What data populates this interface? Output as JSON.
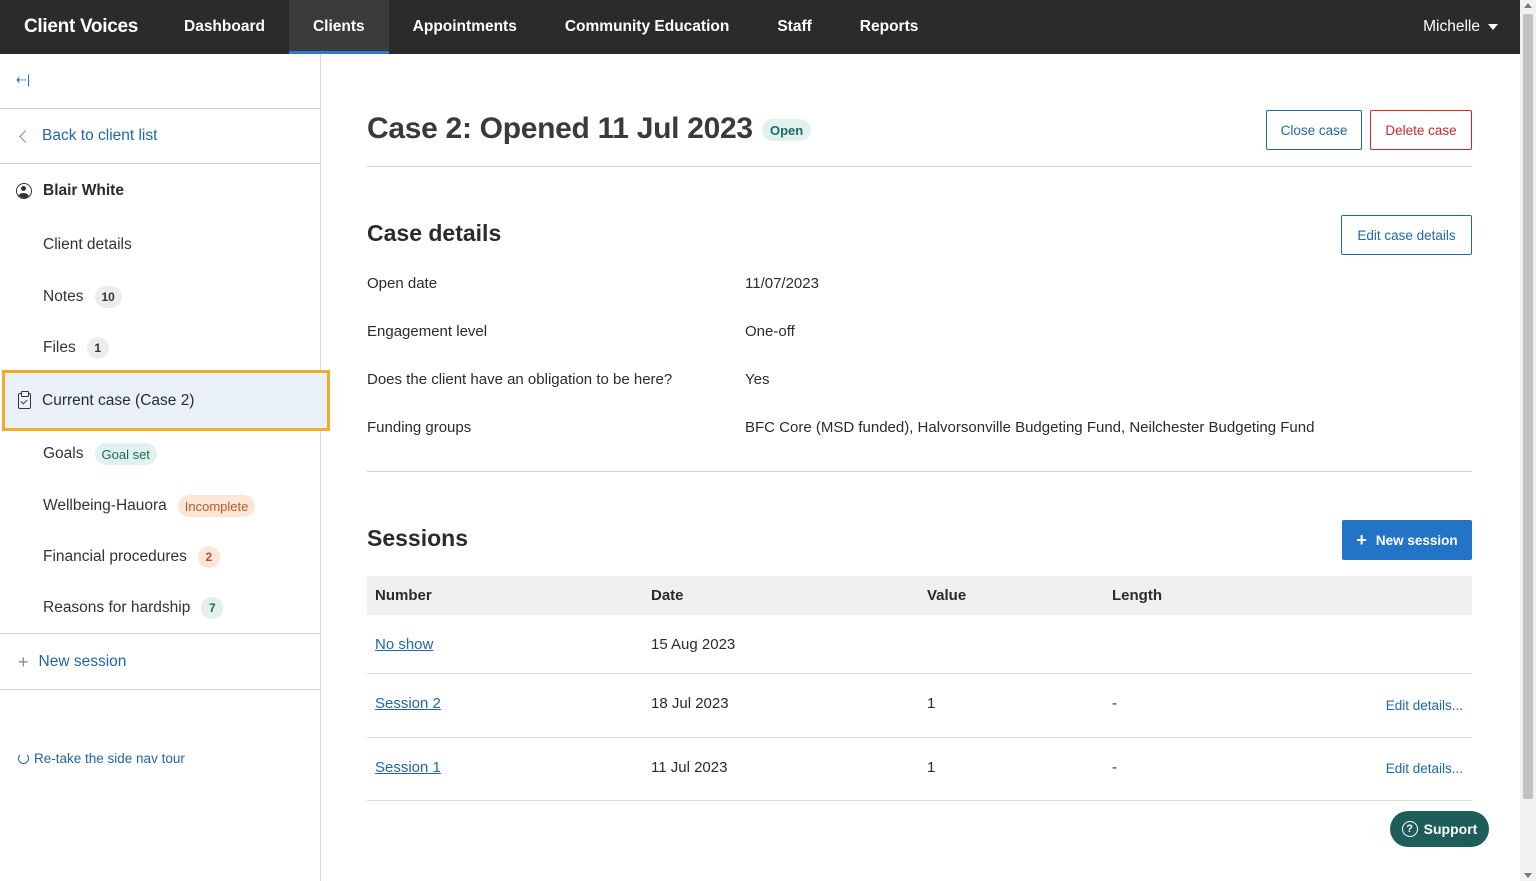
{
  "app": {
    "brand": "Client Voices",
    "user_name": "Michelle"
  },
  "nav": [
    {
      "label": "Dashboard",
      "active": false
    },
    {
      "label": "Clients",
      "active": true
    },
    {
      "label": "Appointments",
      "active": false
    },
    {
      "label": "Community Education",
      "active": false
    },
    {
      "label": "Staff",
      "active": false
    },
    {
      "label": "Reports",
      "active": false
    }
  ],
  "sidebar": {
    "collapse_icon": "collapse-left-icon",
    "back_label": "Back to client list",
    "client_name": "Blair White",
    "items": [
      {
        "label": "Client details"
      },
      {
        "label": "Notes",
        "count": "10"
      },
      {
        "label": "Files",
        "count": "1"
      }
    ],
    "current_case_label": "Current case (Case 2)",
    "case_items": [
      {
        "label": "Goals",
        "badge": "Goal set"
      },
      {
        "label": "Wellbeing-Hauora",
        "badge": "Incomplete"
      },
      {
        "label": "Financial procedures",
        "count": "2"
      },
      {
        "label": "Reasons for hardship",
        "count": "7"
      }
    ],
    "new_session_label": "New session",
    "retake_label": "Re-take the side nav tour"
  },
  "case": {
    "title": "Case 2: Opened 11 Jul 2023",
    "status": "Open",
    "close_label": "Close case",
    "delete_label": "Delete case"
  },
  "details": {
    "heading": "Case details",
    "edit_label": "Edit case details",
    "rows": [
      {
        "label": "Open date",
        "value": "11/07/2023"
      },
      {
        "label": "Engagement level",
        "value": "One-off"
      },
      {
        "label": "Does the client have an obligation to be here?",
        "value": "Yes"
      },
      {
        "label": "Funding groups",
        "value": "BFC Core (MSD funded), Halvorsonville Budgeting Fund, Neilchester Budgeting Fund"
      }
    ]
  },
  "sessions": {
    "heading": "Sessions",
    "new_label": "New session",
    "columns": [
      "Number",
      "Date",
      "Value",
      "Length"
    ],
    "rows": [
      {
        "number": "No show",
        "date": "15 Aug 2023",
        "value": "",
        "length": "",
        "edit": ""
      },
      {
        "number": "Session 2",
        "date": "18 Jul 2023",
        "value": "1",
        "length": "-",
        "edit": "Edit details..."
      },
      {
        "number": "Session 1",
        "date": "11 Jul 2023",
        "value": "1",
        "length": "-",
        "edit": "Edit details..."
      }
    ]
  },
  "support_label": "Support",
  "colors": {
    "nav_bg": "#2b2b2b",
    "accent": "#2374c6",
    "danger": "#c8282e",
    "highlight": "#f2ab2c",
    "support": "#1e5e5a"
  }
}
